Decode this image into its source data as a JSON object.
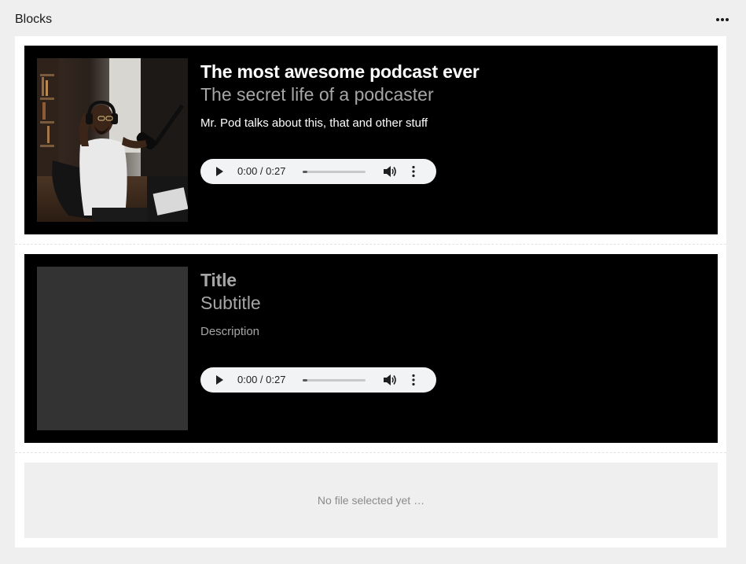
{
  "header": {
    "title": "Blocks",
    "more_icon": "more-horizontal-icon"
  },
  "blocks": [
    {
      "title": "The most awesome podcast ever",
      "subtitle": "The secret life of a podcaster",
      "description": "Mr. Pod talks about this, that and other stuff",
      "cover": "podcaster-photo",
      "audio": {
        "time": "0:00 / 0:27",
        "progress": 0.07,
        "icons": [
          "play-icon",
          "volume-icon",
          "more-vertical-icon"
        ]
      }
    },
    {
      "title": "Title",
      "subtitle": "Subtitle",
      "description": "Description",
      "cover": "empty-cover-placeholder",
      "audio": {
        "time": "0:00 / 0:27",
        "progress": 0.07,
        "icons": [
          "play-icon",
          "volume-icon",
          "more-vertical-icon"
        ]
      }
    }
  ],
  "dropzone": {
    "text": "No file selected yet …"
  },
  "colors": {
    "page_background": "#efefef",
    "block_background": "#000000",
    "muted_text": "#a6a6a6",
    "audio_background": "#f1f3f4",
    "placeholder_cover": "#333333"
  }
}
